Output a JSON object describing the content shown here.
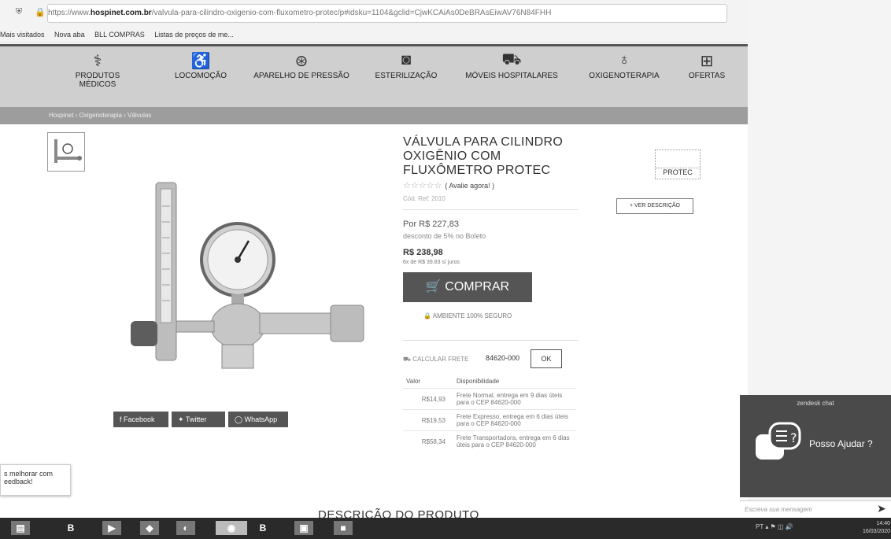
{
  "browser": {
    "url_prefix": "https://www.",
    "url_domain": "hospinet.com.br",
    "url_rest": "/valvula-para-cilindro-oxigenio-com-fluxometro-protec/p#idsku=1104&gclid=CjwKCAiAs0DeBRAsEiwAV76N84FHH",
    "bookmarks": [
      "Mais visitados",
      "Nova aba",
      "BLL COMPRAS",
      "Listas de preços de me..."
    ]
  },
  "categories": [
    {
      "label": "PRODUTOS MÉDICOS",
      "icon": "doctor-icon"
    },
    {
      "label": "LOCOMOÇÃO",
      "icon": "wheelchair-icon"
    },
    {
      "label": "APARELHO DE PRESSÃO",
      "icon": "stethoscope-icon"
    },
    {
      "label": "ESTERILIZAÇÃO",
      "icon": "sterilizer-icon"
    },
    {
      "label": "MÓVEIS HOSPITALARES",
      "icon": "hospital-bed-icon"
    },
    {
      "label": "OXIGENOTERAPIA",
      "icon": "oxygen-icon"
    },
    {
      "label": "OFERTAS",
      "icon": "first-aid-icon"
    }
  ],
  "breadcrumb": "Hospinet  ›  Oxigenoterapia  ›  Válvulas",
  "product": {
    "title": "VÁLVULA PARA CILINDRO OXIGÊNIO COM FLUXÔMETRO PROTEC",
    "rating_label": "( Avalie agora! )",
    "code": "Cód. Ref: 2010",
    "price_cash": "Por R$ 227,83",
    "discount_note": "desconto de 5% no Boleto",
    "price_full": "R$ 238,98",
    "installments": "6x de R$ 39,83 s/ juros",
    "buy_label": "COMPRAR",
    "secure_label": "AMBIENTE 100% SEGURO",
    "brand": "PROTEC",
    "see_description": "+ VER DESCRIÇÃO"
  },
  "shipping": {
    "label": "CALCULAR FRETE",
    "cep": "84620-000",
    "ok_label": "OK",
    "headers": [
      "Valor",
      "Disponibilidade"
    ],
    "rows": [
      {
        "value": "R$14,93",
        "text": "Frete Normal, entrega em 9 dias úteis para o CEP 84620-000"
      },
      {
        "value": "R$19,53",
        "text": "Frete Expresso, entrega em 6 dias úteis para o CEP 84620-000"
      },
      {
        "value": "R$58,34",
        "text": "Frete Transportadora, entrega em 6 dias úteis para o CEP 84620-000"
      }
    ]
  },
  "social": [
    "Facebook",
    "Twitter",
    "WhatsApp"
  ],
  "feedback": "s melhorar com eedback!",
  "description_heading": "DESCRIÇÃO DO PRODUTO",
  "chat": {
    "header": "zendesk chat",
    "message": "Posso Ajudar ?",
    "placeholder": "Escreva sua mensagem"
  },
  "taskbar": {
    "lang": "PT",
    "time": "14:40",
    "date": "16/03/2020"
  }
}
